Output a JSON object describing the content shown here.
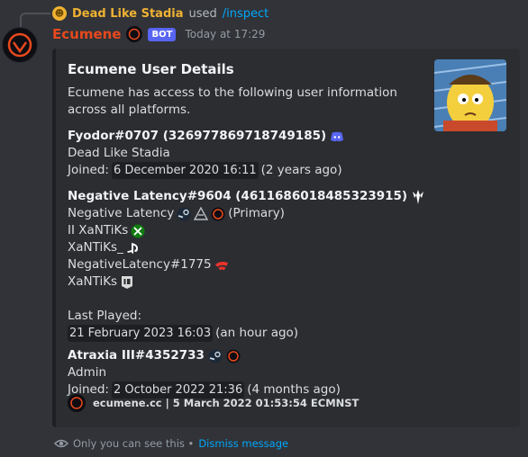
{
  "reply": {
    "user": "Dead Like Stadia",
    "used_text": "used",
    "command": "/inspect"
  },
  "message": {
    "username": "Ecumene",
    "bot_tag": "BOT",
    "timestamp": "Today at 17:29"
  },
  "embed": {
    "title": "Ecumene User Details",
    "description": "Ecumene has access to the following user information across all platforms.",
    "discord": {
      "name": "Fyodor#0707 (326977869718749185)",
      "display": "Dead Like Stadia",
      "joined_label": "Joined:",
      "joined_date": "6 December 2020 16:11",
      "joined_ago": "(2 years ago)"
    },
    "bungie": {
      "name": "Negative Latency#9604 (4611686018485323915)",
      "primary_name": "Negative Latency",
      "primary_tag": "(Primary)",
      "xbox_name": "II XaNTiKs",
      "psn_name": "XaNTiKs_",
      "stadia_name": "NegativeLatency#1775",
      "epic_name": "XaNTiKs",
      "last_played_label": "Last Played:",
      "last_played_date": "21 February 2023 16:03",
      "last_played_ago": "(an hour ago)"
    },
    "clan": {
      "name": "Atraxia III#4352733",
      "rank": "Admin",
      "joined_label": "Joined:",
      "joined_date": "2 October 2022 21:36",
      "joined_ago": "(4 months ago)"
    },
    "footer": "ecumene.cc | 5 March 2022 01:53:54 ECMNST"
  },
  "ephemeral": {
    "text": "Only you can see this •",
    "dismiss": "Dismiss message"
  },
  "colors": {
    "background": "#313338",
    "embed": "#2b2d31",
    "bot_name": "#e8491d",
    "reply_user": "#f0b232",
    "link": "#00a8fc",
    "bot_tag": "#5865f2"
  }
}
